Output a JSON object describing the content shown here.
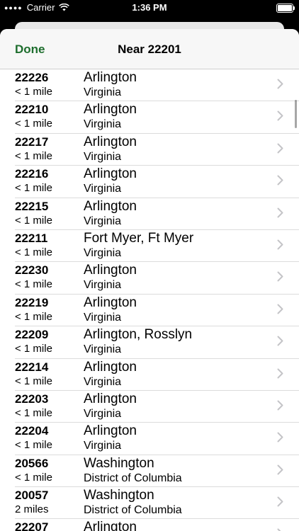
{
  "status_bar": {
    "carrier": "Carrier",
    "time": "1:36 PM"
  },
  "nav": {
    "done_label": "Done",
    "title": "Near 22201"
  },
  "rows": [
    {
      "zip": "22226",
      "distance": "< 1 mile",
      "city": "Arlington",
      "state": "Virginia"
    },
    {
      "zip": "22210",
      "distance": "< 1 mile",
      "city": "Arlington",
      "state": "Virginia"
    },
    {
      "zip": "22217",
      "distance": "< 1 mile",
      "city": "Arlington",
      "state": "Virginia"
    },
    {
      "zip": "22216",
      "distance": "< 1 mile",
      "city": "Arlington",
      "state": "Virginia"
    },
    {
      "zip": "22215",
      "distance": "< 1 mile",
      "city": "Arlington",
      "state": "Virginia"
    },
    {
      "zip": "22211",
      "distance": "< 1 mile",
      "city": "Fort Myer, Ft Myer",
      "state": "Virginia"
    },
    {
      "zip": "22230",
      "distance": "< 1 mile",
      "city": "Arlington",
      "state": "Virginia"
    },
    {
      "zip": "22219",
      "distance": "< 1 mile",
      "city": "Arlington",
      "state": "Virginia"
    },
    {
      "zip": "22209",
      "distance": "< 1 mile",
      "city": "Arlington, Rosslyn",
      "state": "Virginia"
    },
    {
      "zip": "22214",
      "distance": "< 1 mile",
      "city": "Arlington",
      "state": "Virginia"
    },
    {
      "zip": "22203",
      "distance": "< 1 mile",
      "city": "Arlington",
      "state": "Virginia"
    },
    {
      "zip": "22204",
      "distance": "< 1 mile",
      "city": "Arlington",
      "state": "Virginia"
    },
    {
      "zip": "20566",
      "distance": "< 1 mile",
      "city": "Washington",
      "state": "District of Columbia"
    },
    {
      "zip": "20057",
      "distance": "2 miles",
      "city": "Washington",
      "state": "District of Columbia"
    },
    {
      "zip": "22207",
      "distance": "",
      "city": "Arlington",
      "state": ""
    }
  ],
  "colors": {
    "accent": "#1e6e2e",
    "chevron": "#c4c4c7"
  }
}
